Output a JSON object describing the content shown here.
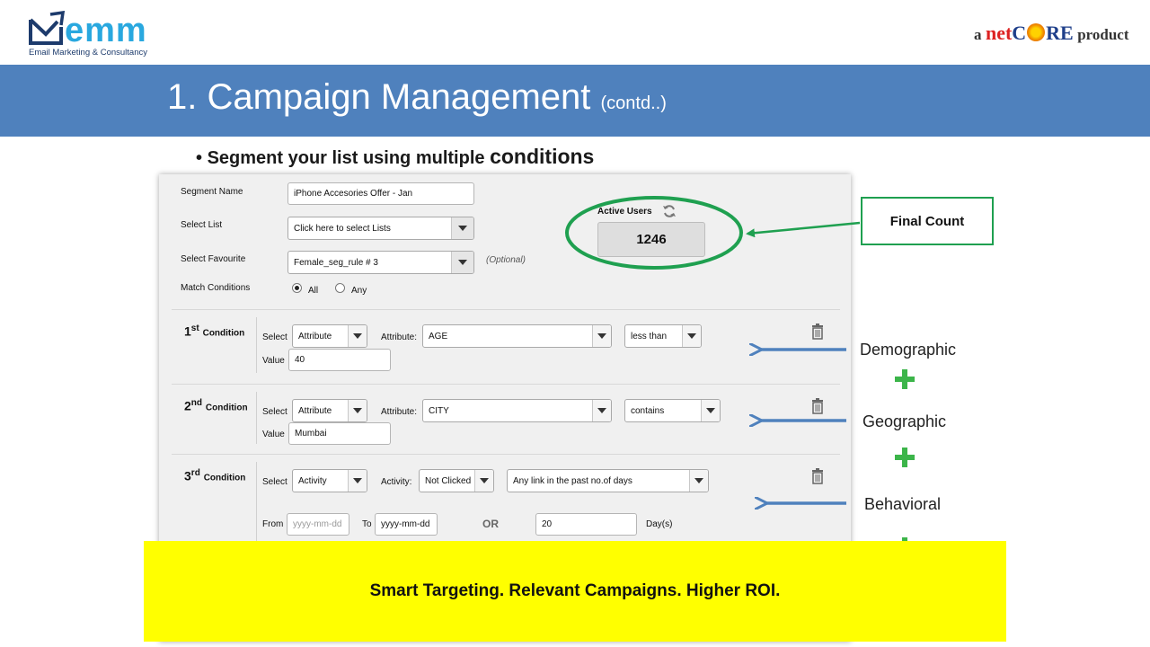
{
  "header": {
    "logo_text": "emm",
    "logo_tagline": "Email Marketing & Consultancy",
    "netcore_a": "a",
    "netcore_net": "net",
    "netcore_c": "C",
    "netcore_re": "RE",
    "netcore_product": "product"
  },
  "title": {
    "main": "1. Campaign Management",
    "sub": "(contd..)"
  },
  "bullet": {
    "text": "Segment your list using multiple",
    "emphasis": "conditions"
  },
  "form": {
    "segment_name_label": "Segment Name",
    "segment_name_value": "iPhone Accesories Offer - Jan",
    "select_list_label": "Select List",
    "select_list_value": "Click here to select Lists",
    "select_favourite_label": "Select Favourite",
    "select_favourite_value": "Female_seg_rule # 3",
    "optional_text": "(Optional)",
    "match_conditions_label": "Match Conditions",
    "match_all_label": "All",
    "match_any_label": "Any",
    "match_selected": "All",
    "active_users_label": "Active Users",
    "active_users_count": "1246"
  },
  "conditions": [
    {
      "ordinal": "1",
      "suffix": "st",
      "word": "Condition",
      "select_label": "Select",
      "select_value": "Attribute",
      "field_label": "Attribute:",
      "field_value": "AGE",
      "operator_value": "less than",
      "value_label": "Value",
      "value": "40"
    },
    {
      "ordinal": "2",
      "suffix": "nd",
      "word": "Condition",
      "select_label": "Select",
      "select_value": "Attribute",
      "field_label": "Attribute:",
      "field_value": "CITY",
      "operator_value": "contains",
      "value_label": "Value",
      "value": "Mumbai"
    },
    {
      "ordinal": "3",
      "suffix": "rd",
      "word": "Condition",
      "select_label": "Select",
      "select_value": "Activity",
      "field_label": "Activity:",
      "field_value": "Not Clicked",
      "operator_value": "Any link in the past no.of days",
      "from_label": "From",
      "from_placeholder": "yyyy-mm-dd",
      "to_label": "To",
      "to_value": "yyyy-mm-dd",
      "or_label": "OR",
      "days_value": "20",
      "days_label": "Day(s)"
    }
  ],
  "annotations": {
    "final_count": "Final Count",
    "demographic": "Demographic",
    "geographic": "Geographic",
    "behavioral": "Behavioral"
  },
  "footer": {
    "tagline": "Smart Targeting. Relevant Campaigns. Higher ROI."
  },
  "colors": {
    "title_bar": "#4f81bd",
    "footer_bg": "#ffff00",
    "highlight_green": "#1fa050",
    "arrow_blue": "#4f81bd",
    "plus_green": "#3cb54a"
  }
}
